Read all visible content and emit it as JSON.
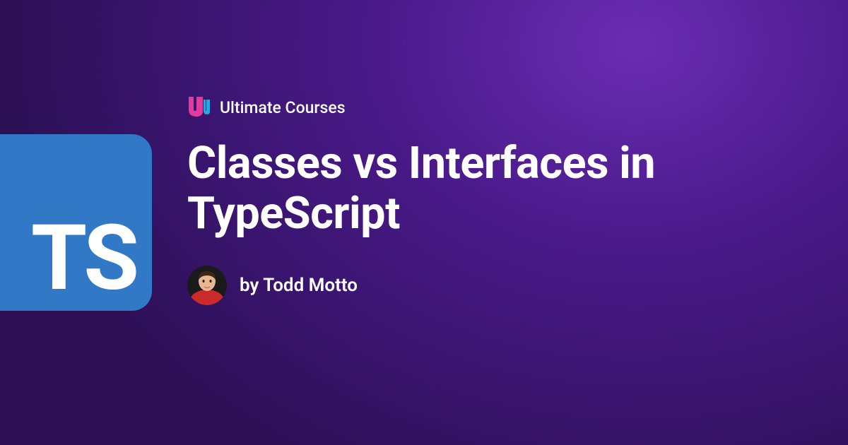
{
  "badge": {
    "text": "TS"
  },
  "brand": {
    "name": "Ultimate Courses"
  },
  "article": {
    "title": "Classes vs Interfaces in TypeScript"
  },
  "author": {
    "byline": "by Todd Motto"
  }
}
